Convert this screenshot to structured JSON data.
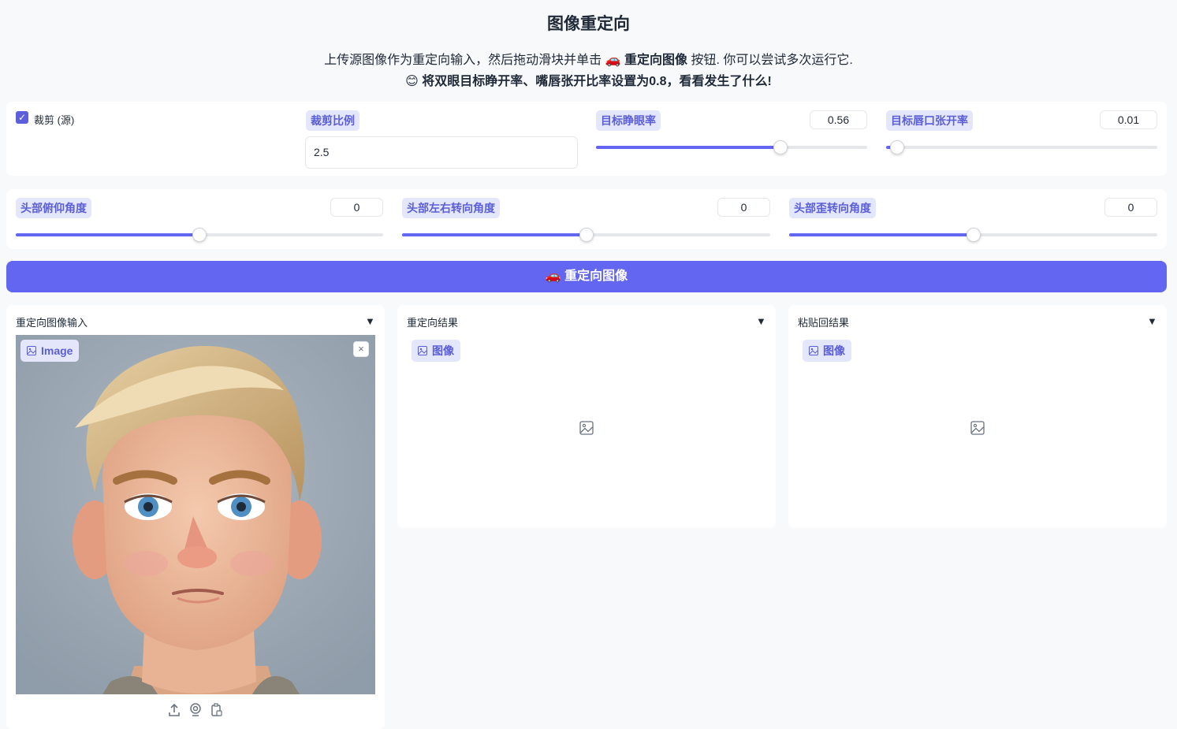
{
  "header": {
    "title": "图像重定向",
    "desc_line1_a": "上传源图像作为重定向输入，然后拖动滑块并单击 🚗 ",
    "desc_line1_bold": "重定向图像",
    "desc_line1_b": " 按钮. 你可以尝试多次运行它.",
    "desc_line2": "😊 将双眼目标睁开率、嘴唇张开比率设置为0.8，看看发生了什么!"
  },
  "row1": {
    "crop_label": "裁剪 (源)",
    "crop_checked": true,
    "crop_ratio_label": "裁剪比例",
    "crop_ratio_value": "2.5",
    "eye_label": "目标睁眼率",
    "eye_value": "0.56",
    "eye_fraction": 0.68,
    "lip_label": "目标唇口张开率",
    "lip_value": "0.01",
    "lip_fraction": 0.04
  },
  "row2": {
    "pitch_label": "头部俯仰角度",
    "pitch_value": "0",
    "pitch_fraction": 0.5,
    "yaw_label": "头部左右转向角度",
    "yaw_value": "0",
    "yaw_fraction": 0.5,
    "roll_label": "头部歪转向角度",
    "roll_value": "0",
    "roll_fraction": 0.5
  },
  "run_button": "🚗 重定向图像",
  "panels": {
    "input_title": "重定向图像输入",
    "input_chip": "Image",
    "result_title": "重定向结果",
    "result_chip": "图像",
    "paste_title": "粘贴回结果",
    "paste_chip": "图像",
    "arrow": "▼",
    "close": "×"
  },
  "colors": {
    "accent": "#6366f1",
    "chip_bg": "#e4e6fb",
    "chip_text": "#5a5fd8"
  }
}
